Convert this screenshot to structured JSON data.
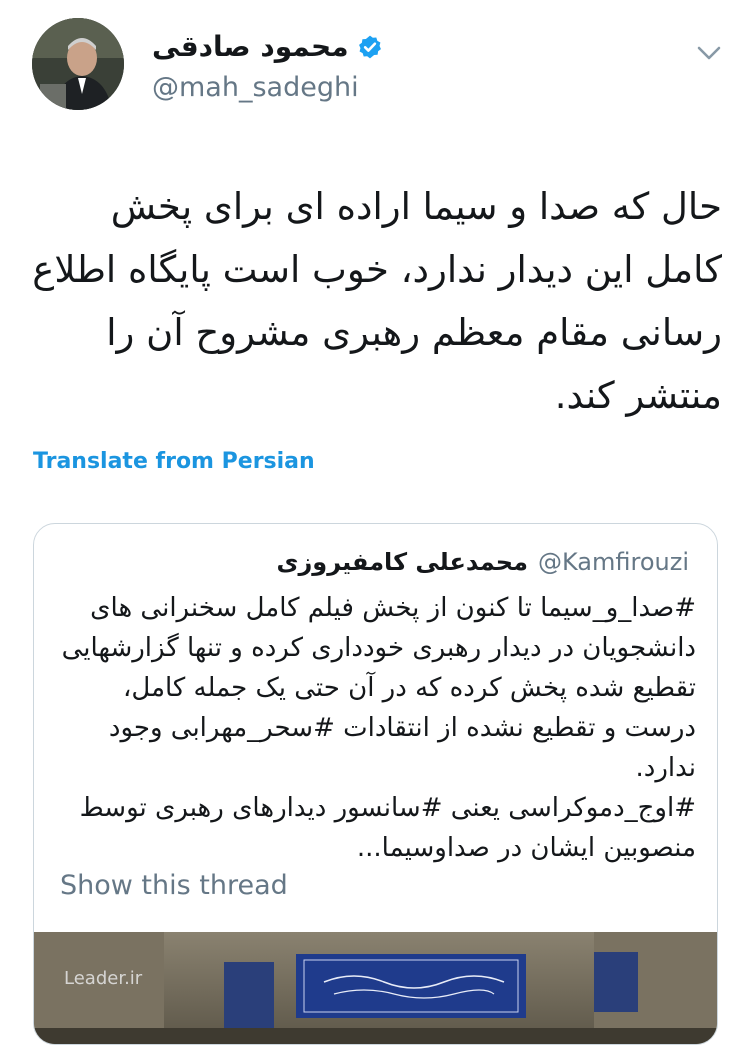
{
  "author": {
    "name": "محمود صادقی",
    "handle": "@mah_sadeghi"
  },
  "tweet": {
    "text": "حال که صدا و سیما اراده ای برای پخش کامل این دیدار ندارد، خوب است پایگاه اطلاع رسانی مقام معظم رهبری مشروح آن را منتشر کند."
  },
  "translate_label": "Translate from Persian",
  "quoted": {
    "name": "محمدعلی کامفیروزی",
    "handle": "@Kamfirouzi",
    "text": "#صدا_و_سیما تا کنون از پخش فیلم کامل سخنرانی های دانشجویان در دیدار رهبری خودداری کرده و تنها گزارشهایی تقطیع شده پخش کرده که در آن حتی یک جمله کامل، درست و تقطیع نشده از انتقادات #سحر_مهرابی وجود ندارد.\n#اوج_دموکراسی یعنی #سانسور دیدارهای رهبری توسط منصوبین ایشان در صداوسیما...",
    "show_thread_label": "Show this thread",
    "media_watermark": "Leader.ir"
  },
  "icons": {
    "verified": "verified-badge-icon",
    "menu": "chevron-down-icon"
  },
  "colors": {
    "link": "#1b95e0",
    "secondary_text": "#657786",
    "border": "#ccd6dd",
    "verified": "#1da1f2"
  }
}
